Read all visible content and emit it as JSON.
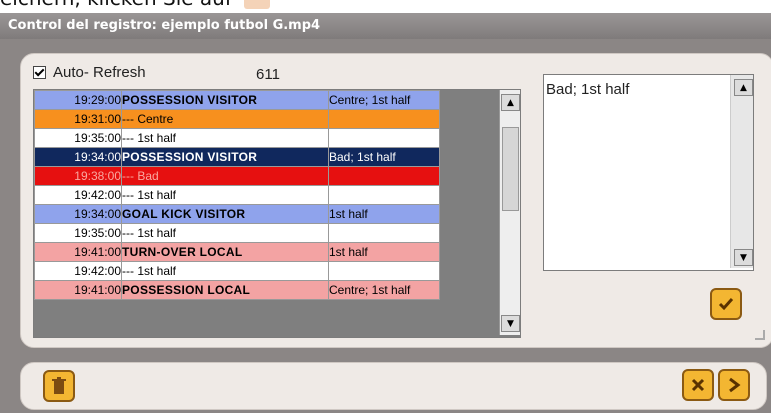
{
  "top_caption": "eichern, klicken Sie auf",
  "window": {
    "title": "Control del registro: ejemplo futbol G.mp4"
  },
  "auto_refresh": {
    "label": "Auto- Refresh",
    "checked": true,
    "count": "611"
  },
  "grid": {
    "rows": [
      {
        "time": "19:29:00",
        "event": "POSSESSION VISITOR",
        "note": "Centre; 1st half",
        "bold": true,
        "color": "#8fa3ec"
      },
      {
        "time": "19:31:00",
        "event": "--- Centre",
        "note": "",
        "bold": false,
        "color": "#f7901e"
      },
      {
        "time": "19:35:00",
        "event": "--- 1st half",
        "note": "",
        "bold": false,
        "color": "#ffffff"
      },
      {
        "time": "19:34:00",
        "event": "POSSESSION VISITOR",
        "note": "Bad; 1st half",
        "bold": true,
        "color": "#10285d"
      },
      {
        "time": "19:38:00",
        "event": "--- Bad",
        "note": "",
        "bold": false,
        "color": "#e61010"
      },
      {
        "time": "19:42:00",
        "event": "--- 1st half",
        "note": "",
        "bold": false,
        "color": "#ffffff"
      },
      {
        "time": "19:34:00",
        "event": "GOAL KICK VISITOR",
        "note": "1st half",
        "bold": true,
        "color": "#8fa3ec"
      },
      {
        "time": "19:35:00",
        "event": "--- 1st half",
        "note": "",
        "bold": false,
        "color": "#ffffff"
      },
      {
        "time": "19:41:00",
        "event": "TURN-OVER LOCAL",
        "note": "1st half",
        "bold": true,
        "color": "#f3a3a3"
      },
      {
        "time": "19:42:00",
        "event": "--- 1st half",
        "note": "",
        "bold": false,
        "color": "#ffffff"
      },
      {
        "time": "19:41:00",
        "event": "POSSESSION LOCAL",
        "note": "Centre; 1st half",
        "bold": true,
        "color": "#f3a3a3"
      }
    ]
  },
  "detail_text": "Bad; 1st half",
  "icons": {
    "delete": "trash-icon",
    "cancel": "close-icon",
    "next": "next-arrow-icon",
    "confirm": "checkmark-icon"
  }
}
